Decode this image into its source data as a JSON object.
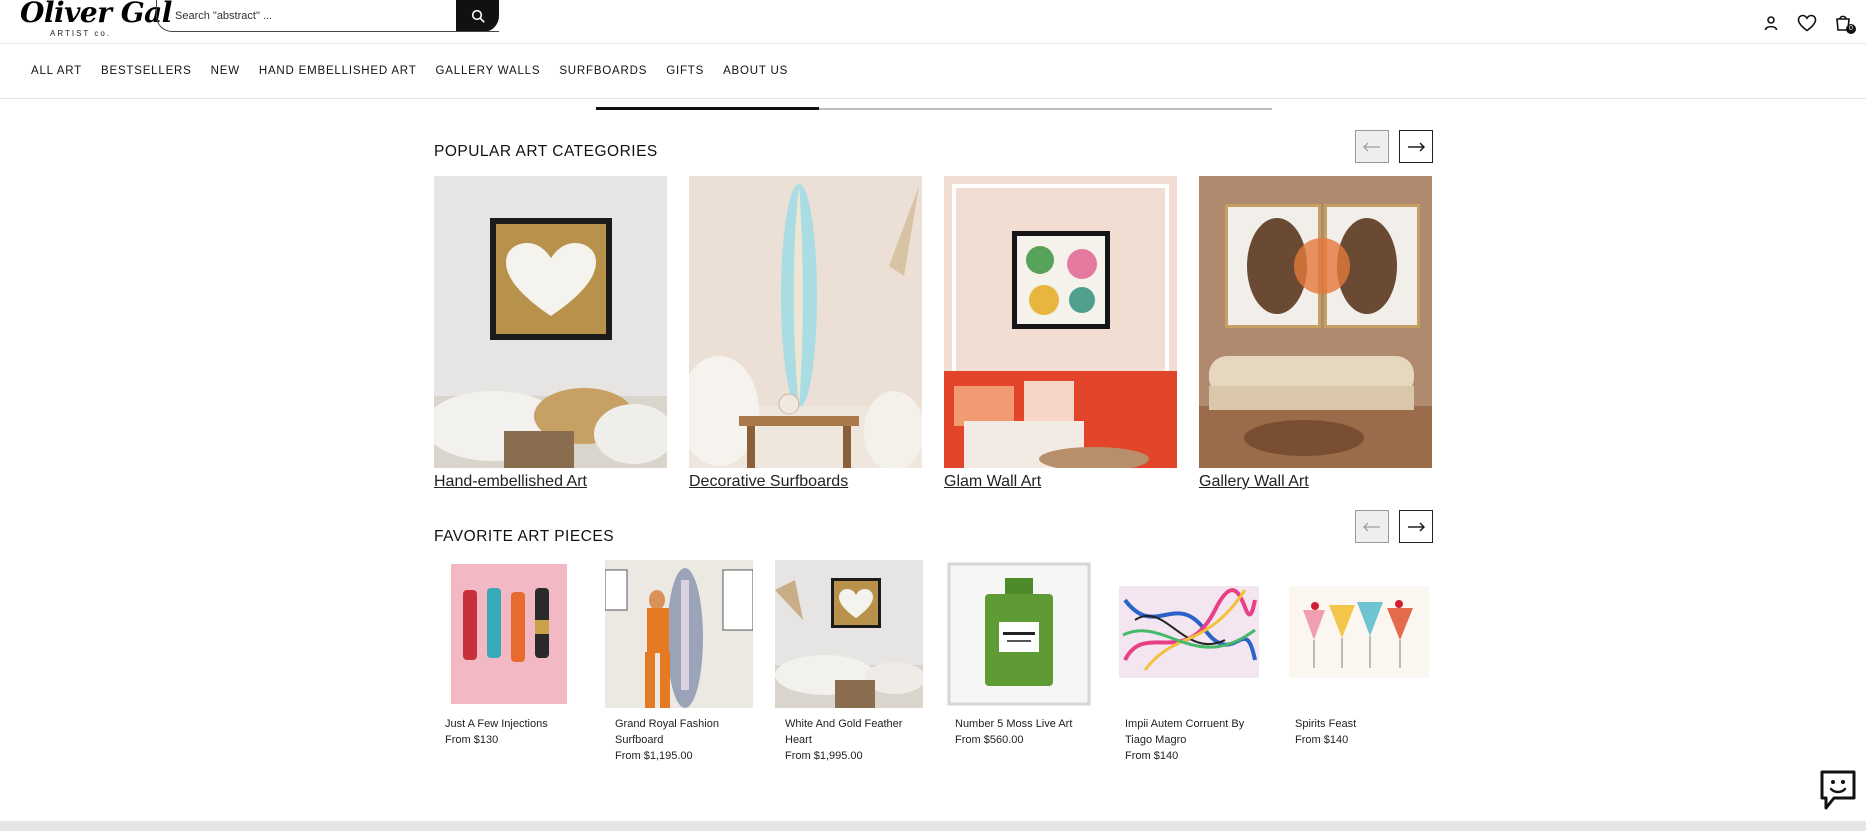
{
  "brand": {
    "logo_text": "Oliver Gal",
    "logo_sub": "ARTIST co."
  },
  "search": {
    "placeholder": "Search \"abstract\" ..."
  },
  "header_icons": [
    "account-icon",
    "heart-icon",
    "cart-icon"
  ],
  "cart": {
    "count": "0"
  },
  "nav": [
    "ALL ART",
    "BESTSELLERS",
    "NEW",
    "HAND EMBELLISHED ART",
    "GALLERY WALLS",
    "SURFBOARDS",
    "GIFTS",
    "ABOUT US"
  ],
  "hero_progress": 0.33,
  "popular": {
    "title": "POPULAR ART CATEGORIES",
    "items": [
      {
        "label": "Hand-embellished Art"
      },
      {
        "label": "Decorative Surfboards"
      },
      {
        "label": "Glam Wall Art"
      },
      {
        "label": "Gallery Wall Art"
      }
    ]
  },
  "favorites": {
    "title": "FAVORITE ART PIECES",
    "items": [
      {
        "name": "Just A Few Injections",
        "price": "From $130"
      },
      {
        "name": "Grand Royal Fashion Surfboard",
        "price": "From $1,195.00"
      },
      {
        "name": "White And Gold Feather Heart",
        "price": "From $1,995.00"
      },
      {
        "name": "Number 5 Moss Live Art",
        "price": "From $560.00"
      },
      {
        "name": "Impii Autem Corruent By Tiago Magro",
        "price": "From $140"
      },
      {
        "name": "Spirits Feast",
        "price": "From $140"
      }
    ]
  },
  "colors": {
    "accent": "#111111",
    "disabled_bg": "#eeeeee"
  }
}
